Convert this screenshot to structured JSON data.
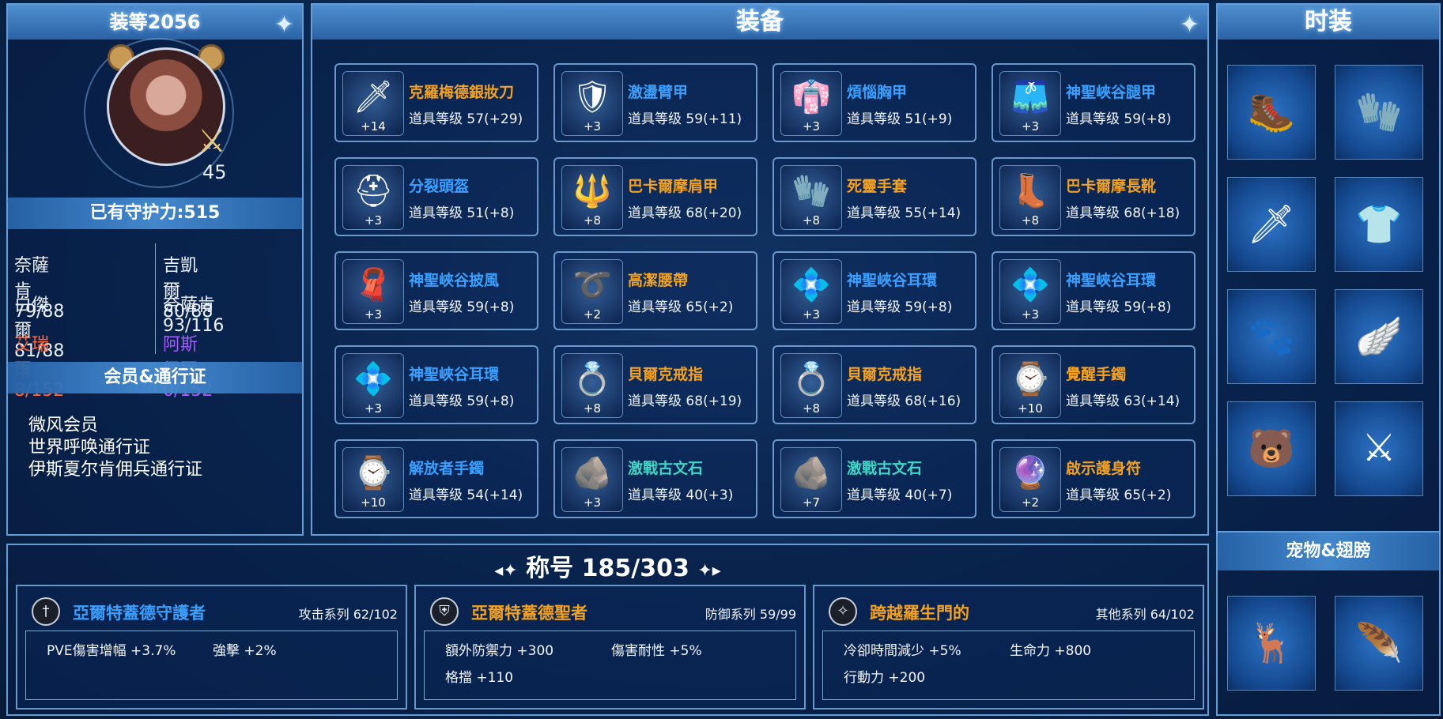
{
  "colors": {
    "orange": "#f4a21e",
    "blue": "#3aa0ff",
    "teal": "#3fd6c6",
    "red": "#ff6a3d",
    "purple": "#a45cff"
  },
  "profile": {
    "gear_score": "装等2056",
    "level": "45",
    "guardian": "已有守护力:515",
    "stats": [
      {
        "text": "奈薩肯 79/88",
        "color": "#ecf1fa"
      },
      {
        "text": "吉凱爾 80/88",
        "color": "#ecf1fa"
      },
      {
        "text": "白傑爾 81/88",
        "color": "#ecf1fa"
      },
      {
        "text": "奈薩肯 93/116",
        "color": "#ecf1fa"
      },
      {
        "text": "艾瑞爾 8/152",
        "color": "#ff6a3d"
      },
      {
        "text": "阿斯佩爾 0/152",
        "color": "#a45cff"
      }
    ],
    "membership_head": "会员&通行证",
    "memberships": [
      "微风会员",
      "世界呼唤通行证",
      "伊斯夏尔肯佣兵通行证"
    ]
  },
  "equipment": {
    "title": "装备",
    "items": [
      {
        "name": "克羅梅德銀妝刀",
        "level": "道具等级 57(+29)",
        "plus": "+14",
        "color": "#f4a21e",
        "icon": "dagger-icon"
      },
      {
        "name": "激盪臂甲",
        "level": "道具等级 59(+11)",
        "plus": "+3",
        "color": "#3aa0ff",
        "icon": "bracer-icon"
      },
      {
        "name": "煩惱胸甲",
        "level": "道具等级 51(+9)",
        "plus": "+3",
        "color": "#3aa0ff",
        "icon": "chest-armor-icon"
      },
      {
        "name": "神聖峽谷腿甲",
        "level": "道具等级 59(+8)",
        "plus": "+3",
        "color": "#3aa0ff",
        "icon": "leg-armor-icon"
      },
      {
        "name": "分裂頭盔",
        "level": "道具等级 51(+8)",
        "plus": "+3",
        "color": "#3aa0ff",
        "icon": "helmet-icon"
      },
      {
        "name": "巴卡爾摩肩甲",
        "level": "道具等级 68(+20)",
        "plus": "+8",
        "color": "#f4a21e",
        "icon": "shoulder-armor-icon"
      },
      {
        "name": "死靈手套",
        "level": "道具等级 55(+14)",
        "plus": "+8",
        "color": "#f4a21e",
        "icon": "gloves-icon"
      },
      {
        "name": "巴卡爾摩長靴",
        "level": "道具等级 68(+18)",
        "plus": "+8",
        "color": "#f4a21e",
        "icon": "boots-icon"
      },
      {
        "name": "神聖峽谷披風",
        "level": "道具等级 59(+8)",
        "plus": "+3",
        "color": "#3aa0ff",
        "icon": "cape-icon"
      },
      {
        "name": "高潔腰帶",
        "level": "道具等级 65(+2)",
        "plus": "+2",
        "color": "#f4a21e",
        "icon": "belt-icon"
      },
      {
        "name": "神聖峽谷耳環",
        "level": "道具等级 59(+8)",
        "plus": "+3",
        "color": "#3aa0ff",
        "icon": "earring-icon"
      },
      {
        "name": "神聖峽谷耳環",
        "level": "道具等级 59(+8)",
        "plus": "+3",
        "color": "#3aa0ff",
        "icon": "earring-icon"
      },
      {
        "name": "神聖峽谷耳環",
        "level": "道具等级 59(+8)",
        "plus": "+3",
        "color": "#3aa0ff",
        "icon": "earring-icon"
      },
      {
        "name": "貝爾克戒指",
        "level": "道具等级 68(+19)",
        "plus": "+8",
        "color": "#f4a21e",
        "icon": "ring-icon"
      },
      {
        "name": "貝爾克戒指",
        "level": "道具等级 68(+16)",
        "plus": "+8",
        "color": "#f4a21e",
        "icon": "ring-icon"
      },
      {
        "name": "覺醒手鐲",
        "level": "道具等级 63(+14)",
        "plus": "+10",
        "color": "#f4a21e",
        "icon": "bracelet-icon"
      },
      {
        "name": "解放者手鐲",
        "level": "道具等级 54(+14)",
        "plus": "+10",
        "color": "#3aa0ff",
        "icon": "bracelet-icon"
      },
      {
        "name": "激戰古文石",
        "level": "道具等级 40(+3)",
        "plus": "+3",
        "color": "#3fd6c6",
        "icon": "rune-stone-icon"
      },
      {
        "name": "激戰古文石",
        "level": "道具等级 40(+7)",
        "plus": "+7",
        "color": "#3fd6c6",
        "icon": "rune-stone-icon"
      },
      {
        "name": "啟示護身符",
        "level": "道具等级 65(+2)",
        "plus": "+2",
        "color": "#f4a21e",
        "icon": "amulet-icon"
      }
    ]
  },
  "fashion": {
    "title": "时装",
    "slots": [
      "boots-icon",
      "glove-icon",
      "weapon-skin-icon",
      "shirt-icon",
      "paw-badge-icon",
      "feather-wing-icon",
      "bear-ears-icon",
      "sword-skin-icon"
    ],
    "pet_head": "宠物&翅膀",
    "pets": [
      "pet-creature-icon",
      "wings-icon"
    ]
  },
  "titles": {
    "heading": "称号 185/303",
    "cards": [
      {
        "name": "亞爾特蓋德守護者",
        "color": "#3aa0ff",
        "series": "攻击系列 62/102",
        "stats": [
          "PVE傷害增幅 +3.7%",
          "強擊 +2%"
        ]
      },
      {
        "name": "亞爾特蓋德聖者",
        "color": "#f4a21e",
        "series": "防御系列 59/99",
        "stats": [
          "額外防禦力 +300",
          "傷害耐性 +5%",
          "格擋 +110"
        ]
      },
      {
        "name": "跨越羅生門的",
        "color": "#f4a21e",
        "series": "其他系列 64/102",
        "stats": [
          "冷卻時間減少 +5%",
          "生命力 +800",
          "行動力 +200"
        ]
      }
    ]
  }
}
